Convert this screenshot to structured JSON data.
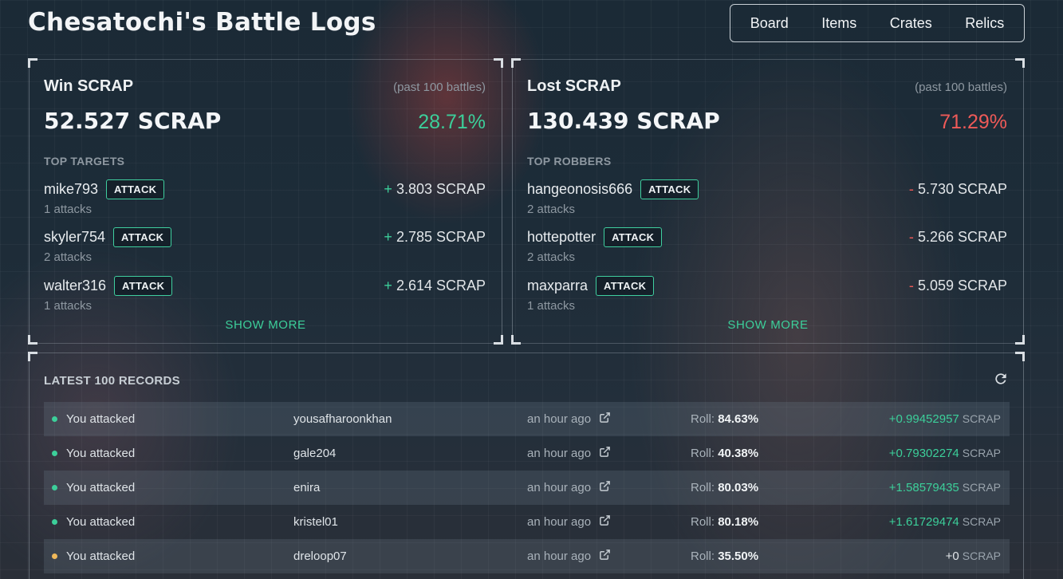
{
  "page": {
    "title": "Chesatochi's Battle Logs"
  },
  "nav": {
    "items": [
      "Board",
      "Items",
      "Crates",
      "Relics"
    ]
  },
  "win": {
    "title": "Win SCRAP",
    "subtitle": "(past 100 battles)",
    "amount": "52.527 SCRAP",
    "percent": "28.71%",
    "section_label": "TOP TARGETS",
    "rows": [
      {
        "name": "mike793",
        "button": "ATTACK",
        "sign": "+",
        "amount": "3.803 SCRAP",
        "count": "1 attacks"
      },
      {
        "name": "skyler754",
        "button": "ATTACK",
        "sign": "+",
        "amount": "2.785 SCRAP",
        "count": "2 attacks"
      },
      {
        "name": "walter316",
        "button": "ATTACK",
        "sign": "+",
        "amount": "2.614 SCRAP",
        "count": "1 attacks"
      }
    ],
    "show_more": "SHOW MORE"
  },
  "lost": {
    "title": "Lost SCRAP",
    "subtitle": "(past 100 battles)",
    "amount": "130.439 SCRAP",
    "percent": "71.29%",
    "section_label": "TOP ROBBERS",
    "rows": [
      {
        "name": "hangeonosis666",
        "button": "ATTACK",
        "sign": "-",
        "amount": "5.730 SCRAP",
        "count": "2 attacks"
      },
      {
        "name": "hottepotter",
        "button": "ATTACK",
        "sign": "-",
        "amount": "5.266 SCRAP",
        "count": "2 attacks"
      },
      {
        "name": "maxparra",
        "button": "ATTACK",
        "sign": "-",
        "amount": "5.059 SCRAP",
        "count": "1 attacks"
      }
    ],
    "show_more": "SHOW MORE"
  },
  "records": {
    "title": "LATEST 100 RECORDS",
    "roll_label": "Roll:",
    "unit": "SCRAP",
    "colors": {
      "win": "#3ccf9a",
      "draw": "#f0b95a"
    },
    "rows": [
      {
        "action": "You attacked",
        "user": "yousafharoonkhan",
        "time": "an hour ago",
        "roll": "84.63%",
        "amount": "+0.99452957",
        "status": "win"
      },
      {
        "action": "You attacked",
        "user": "gale204",
        "time": "an hour ago",
        "roll": "40.38%",
        "amount": "+0.79302274",
        "status": "win"
      },
      {
        "action": "You attacked",
        "user": "enira",
        "time": "an hour ago",
        "roll": "80.03%",
        "amount": "+1.58579435",
        "status": "win"
      },
      {
        "action": "You attacked",
        "user": "kristel01",
        "time": "an hour ago",
        "roll": "80.18%",
        "amount": "+1.61729474",
        "status": "win"
      },
      {
        "action": "You attacked",
        "user": "dreloop07",
        "time": "an hour ago",
        "roll": "35.50%",
        "amount": "+0",
        "status": "draw"
      }
    ]
  }
}
